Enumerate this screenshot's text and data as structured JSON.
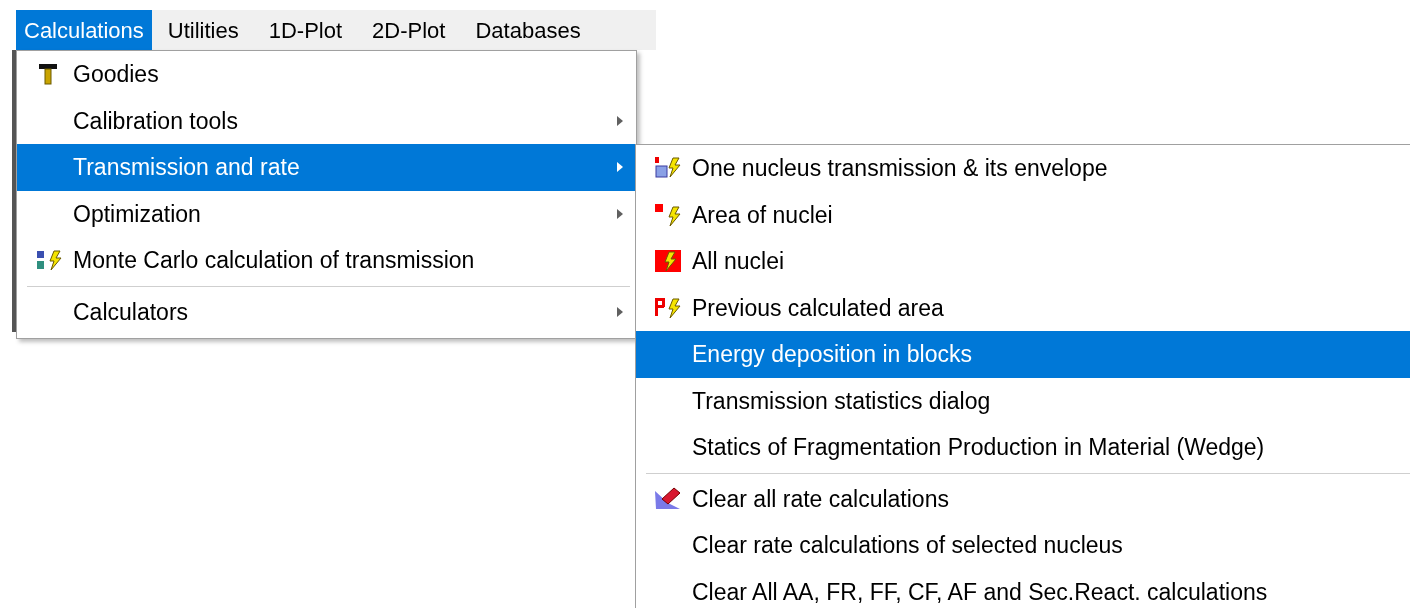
{
  "menubar": [
    {
      "label": "Calculations",
      "selected": true
    },
    {
      "label": "Utilities",
      "selected": false
    },
    {
      "label": "1D-Plot",
      "selected": false
    },
    {
      "label": "2D-Plot",
      "selected": false
    },
    {
      "label": "Databases",
      "selected": false
    }
  ],
  "menu": [
    {
      "kind": "item",
      "label": "Goodies",
      "submenu": false,
      "selected": false
    },
    {
      "kind": "item",
      "label": "Calibration tools",
      "submenu": true,
      "selected": false
    },
    {
      "kind": "item",
      "label": "Transmission and rate",
      "submenu": true,
      "selected": true
    },
    {
      "kind": "item",
      "label": "Optimization",
      "submenu": true,
      "selected": false
    },
    {
      "kind": "item",
      "label": "Monte Carlo calculation of transmission",
      "submenu": false,
      "selected": false
    },
    {
      "kind": "separator"
    },
    {
      "kind": "item",
      "label": "Calculators",
      "submenu": true,
      "selected": false
    }
  ],
  "submenu": [
    {
      "kind": "item",
      "label": "One nucleus transmission & its envelope",
      "selected": false
    },
    {
      "kind": "item",
      "label": "Area of nuclei",
      "selected": false
    },
    {
      "kind": "item",
      "label": "All nuclei",
      "selected": false
    },
    {
      "kind": "item",
      "label": "Previous calculated area",
      "selected": false
    },
    {
      "kind": "item",
      "label": "Energy deposition in blocks",
      "selected": true
    },
    {
      "kind": "item",
      "label": "Transmission statistics dialog",
      "selected": false
    },
    {
      "kind": "item",
      "label": "Statics of Fragmentation Production in Material (Wedge)",
      "selected": false
    },
    {
      "kind": "separator"
    },
    {
      "kind": "item",
      "label": "Clear all rate calculations",
      "selected": false
    },
    {
      "kind": "item",
      "label": "Clear rate calculations of selected nucleus",
      "selected": false
    },
    {
      "kind": "item",
      "label": "Clear All AA, FR, FF, CF, AF and Sec.React. calculations",
      "selected": false
    }
  ]
}
